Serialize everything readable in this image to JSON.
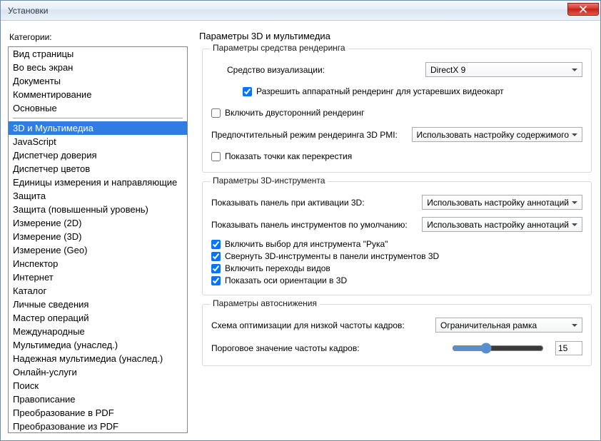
{
  "window": {
    "title": "Установки"
  },
  "sidebar": {
    "label": "Категории:",
    "groups": [
      [
        "Вид страницы",
        "Во весь экран",
        "Документы",
        "Комментирование",
        "Основные"
      ],
      [
        "3D и Мультимедиа",
        "JavaScript",
        "Диспетчер доверия",
        "Диспетчер цветов",
        "Единицы измерения и направляющие",
        "Защита",
        "Защита (повышенный уровень)",
        "Измерение (2D)",
        "Измерение (3D)",
        "Измерение (Geo)",
        "Инспектор",
        "Интернет",
        "Каталог",
        "Личные сведения",
        "Мастер операций",
        "Международные",
        "Мультимедиа (унаслед.)",
        "Надежная мультимедиа (унаслед.)",
        "Онлайн-услуги",
        "Поиск",
        "Правописание",
        "Преобразование в PDF",
        "Преобразование из PDF"
      ]
    ],
    "selected": "3D и Мультимедиа"
  },
  "page": {
    "title": "Параметры 3D и мультимедиа",
    "groups": {
      "render": {
        "title": "Параметры средства рендеринга",
        "vis_label": "Средство визуализации:",
        "vis_value": "DirectX 9",
        "allow_hw": {
          "label": "Разрешить аппаратный рендеринг для устаревших видеокарт",
          "checked": true
        },
        "double_sided": {
          "label": "Включить двусторонний рендеринг",
          "checked": false
        },
        "pmi_label": "Предпочтительный режим рендеринга 3D PMI:",
        "pmi_value": "Использовать настройку содержимого",
        "crosshair": {
          "label": "Показать точки как перекрестия",
          "checked": false
        }
      },
      "tool": {
        "title": "Параметры 3D-инструмента",
        "panel_on_activate_label": "Показывать панель при активации 3D:",
        "panel_on_activate_value": "Использовать настройку аннотаций",
        "default_panel_label": "Показывать панель инструментов по умолчанию:",
        "default_panel_value": "Использовать настройку аннотаций",
        "hand": {
          "label": "Включить выбор для инструмента \"Рука\"",
          "checked": true
        },
        "collapse": {
          "label": "Свернуть 3D-инструменты в панели инструментов 3D",
          "checked": true
        },
        "transitions": {
          "label": "Включить переходы видов",
          "checked": true
        },
        "axes": {
          "label": "Показать оси ориентации в 3D",
          "checked": true
        }
      },
      "auto": {
        "title": "Параметры автоснижения",
        "scheme_label": "Схема оптимизации для низкой частоты кадров:",
        "scheme_value": "Ограничительная рамка",
        "threshold_label": "Пороговое значение частоты кадров:",
        "threshold_value": "15"
      }
    }
  }
}
